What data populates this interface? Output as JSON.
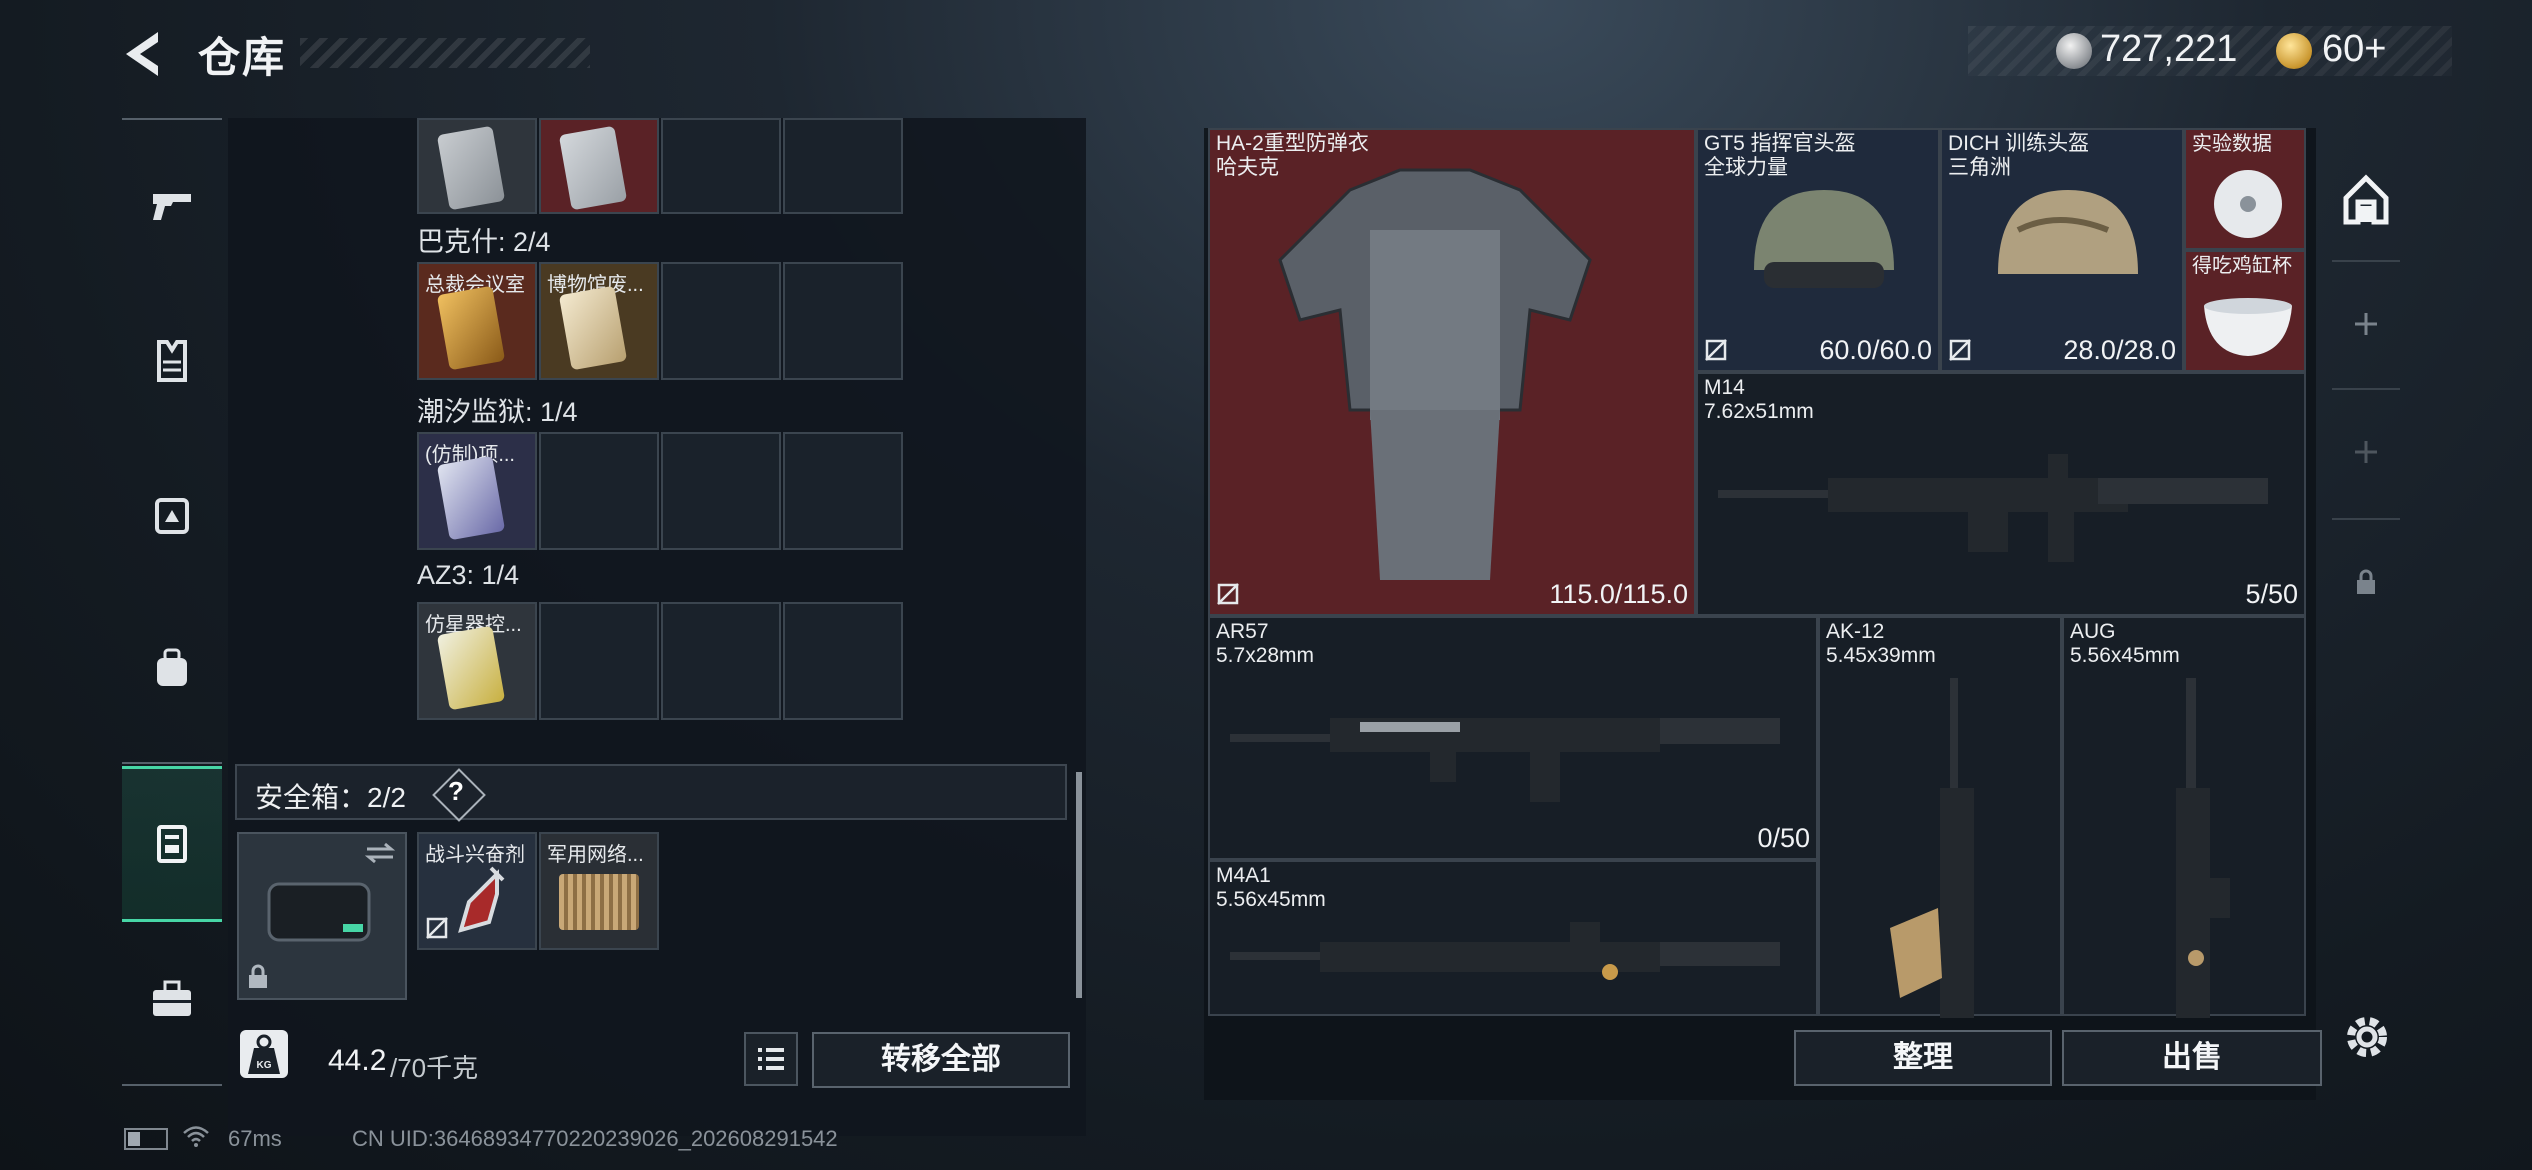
{
  "header": {
    "title": "仓库",
    "currency_silver": "727,221",
    "currency_gold": "60+"
  },
  "left_nav": [
    "weapon-icon",
    "armor-icon",
    "rig-icon",
    "backpack-icon",
    "safebox-icon",
    "case-icon"
  ],
  "left_panel": {
    "groups": [
      {
        "label": "巴克什: 2/4",
        "items": [
          "总裁会议室",
          "博物馆废..."
        ]
      },
      {
        "label": "潮汐监狱: 1/4",
        "items": [
          "(仿制)项..."
        ]
      },
      {
        "label": "AZ3: 1/4",
        "items": [
          "仿星器控..."
        ]
      }
    ],
    "safe_box": {
      "label": "安全箱：2/2",
      "help": "?",
      "items": [
        "战斗兴奋剂",
        "军用网络..."
      ]
    },
    "weight": {
      "value": "44.2",
      "capacity": "/70千克",
      "icon_label": "KG"
    },
    "transfer_all": "转移全部"
  },
  "right_panel": {
    "items": [
      {
        "name": "HA-2重型防弹衣",
        "sub": "哈夫克",
        "value": "115.0/115.0"
      },
      {
        "name": "GT5 指挥官头盔",
        "sub": "全球力量",
        "value": "60.0/60.0"
      },
      {
        "name": "DICH 训练头盔",
        "sub": "三角洲",
        "value": "28.0/28.0"
      },
      {
        "name": "实验数据",
        "sub": "",
        "value": ""
      },
      {
        "name": "得吃鸡缸杯",
        "sub": "",
        "value": ""
      },
      {
        "name": "M14",
        "sub": "7.62x51mm",
        "value": "5/50"
      },
      {
        "name": "AR57",
        "sub": "5.7x28mm",
        "value": "0/50"
      },
      {
        "name": "AK-12",
        "sub": "5.45x39mm",
        "value": ""
      },
      {
        "name": "AUG",
        "sub": "5.56x45mm",
        "value": ""
      },
      {
        "name": "M4A1",
        "sub": "5.56x45mm",
        "value": ""
      }
    ],
    "sort": "整理",
    "sell": "出售"
  },
  "status_bar": {
    "ping": "67ms",
    "uid": "CN UID:3646893477022023902​6_202608291542"
  },
  "colors": {
    "accent": "#47d6a6",
    "red_slot": "#5a2226",
    "blue_slot": "#1f2a3c"
  }
}
